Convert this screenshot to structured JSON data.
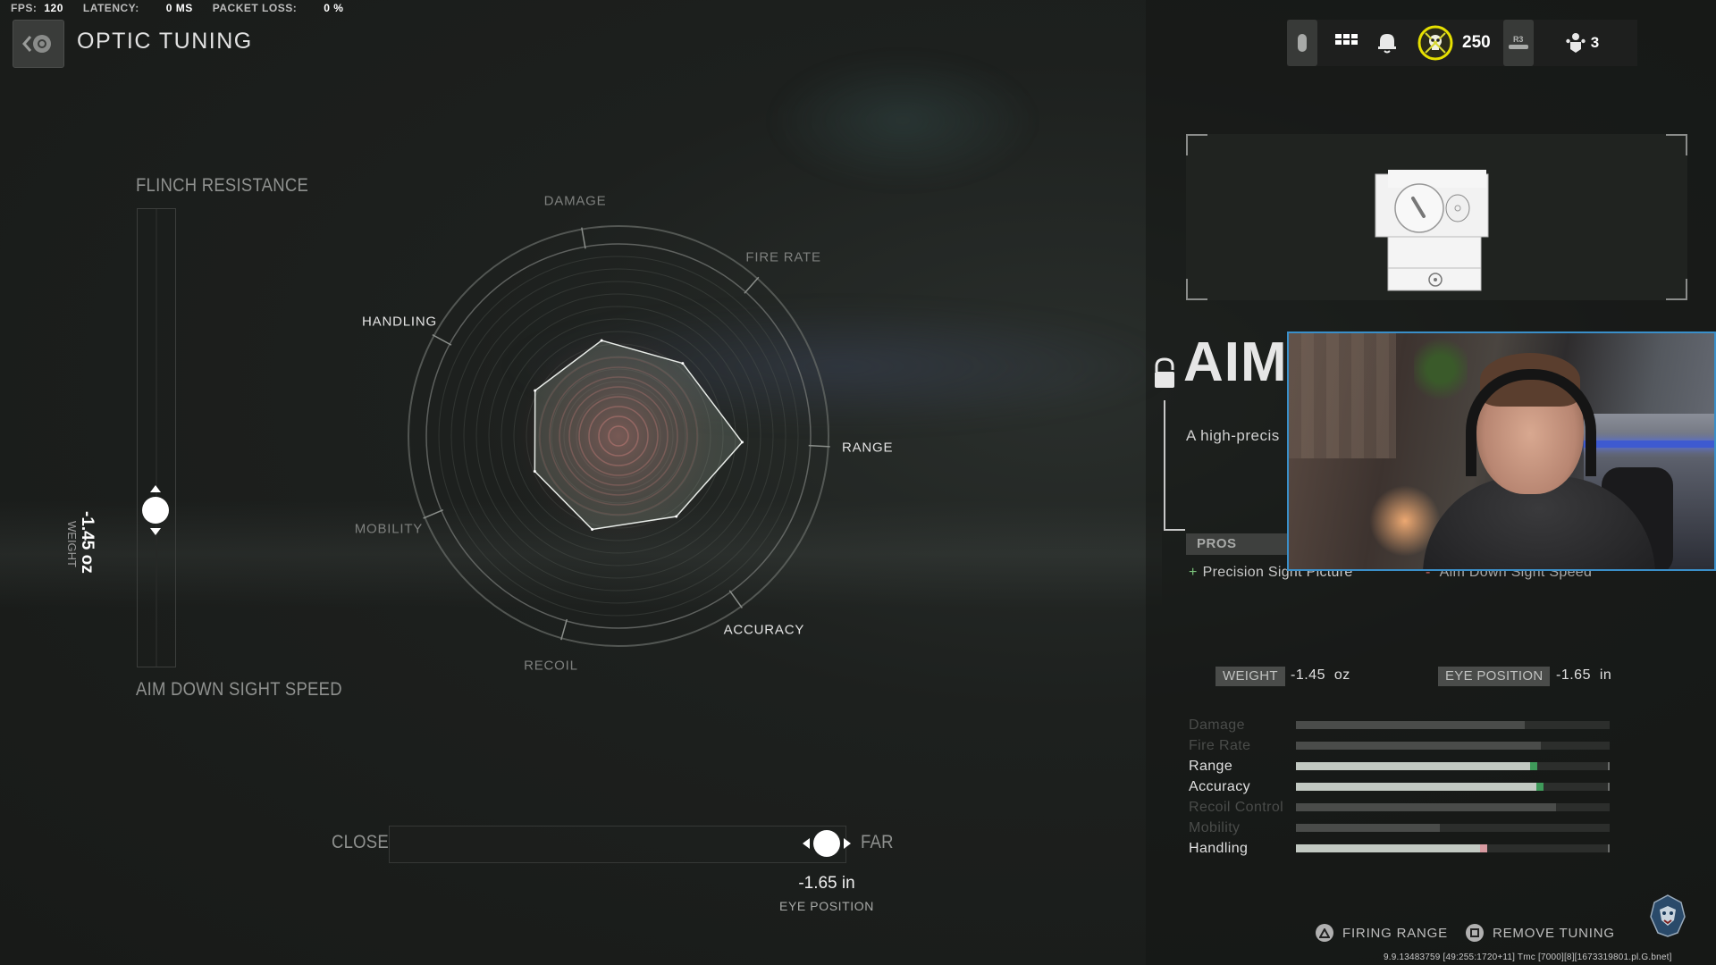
{
  "perf": {
    "fps_label": "FPS:",
    "fps_value": "120",
    "latency_label": "LATENCY:",
    "latency_value": "0 MS",
    "packet_loss_label": "PACKET LOSS:",
    "packet_loss_value": "0 %"
  },
  "header": {
    "back_icon": "back-optic-icon",
    "title": "OPTIC TUNING"
  },
  "topbar": {
    "touchpad_icon": "touchpad-icon",
    "menu_icon": "grid-menu-icon",
    "notifications_icon": "bell-icon",
    "currency_icon": "cod-points-icon",
    "currency_value": "250",
    "r3_label": "R3",
    "squad_icon": "party-icon",
    "squad_count": "3"
  },
  "vertical_tuning": {
    "top_label": "FLINCH RESISTANCE",
    "bottom_label": "AIM DOWN SIGHT SPEED",
    "value": "-1.45 oz",
    "value_name": "WEIGHT",
    "position_from_bottom": 0.34
  },
  "horizontal_tuning": {
    "left_label": "CLOSE",
    "right_label": "FAR",
    "value": "-1.65 in",
    "value_name": "EYE POSITION",
    "position_from_left": 0.96
  },
  "radar": {
    "axes": [
      {
        "label": "DAMAGE",
        "value": 0.47,
        "lit": false
      },
      {
        "label": "FIRE RATE",
        "value": 0.47,
        "lit": false
      },
      {
        "label": "RANGE",
        "value": 0.6,
        "lit": true
      },
      {
        "label": "ACCURACY",
        "value": 0.48,
        "lit": true
      },
      {
        "label": "RECOIL",
        "value": 0.47,
        "lit": false
      },
      {
        "label": "MOBILITY",
        "value": 0.44,
        "lit": false
      },
      {
        "label": "HANDLING",
        "value": 0.46,
        "lit": true
      }
    ]
  },
  "attachment": {
    "name": "AIM",
    "description": "A high-precis",
    "lock_icon": "unlocked-padlock-icon",
    "pros_header": "PROS",
    "pros": [
      "Precision Sight Picture"
    ],
    "cons": [
      "Aim Down Sight Speed"
    ],
    "pro_prefix": "+",
    "con_prefix": "-"
  },
  "tuning_readout": {
    "weight_label": "WEIGHT",
    "weight_value": "-1.45  oz",
    "eye_label": "EYE POSITION",
    "eye_value": "-1.65  in"
  },
  "stats": [
    {
      "name": "Damage",
      "value": 0.73,
      "lit": false,
      "tip": null
    },
    {
      "name": "Fire Rate",
      "value": 0.78,
      "lit": false,
      "tip": null
    },
    {
      "name": "Range",
      "value": 0.77,
      "lit": true,
      "tip": "#3f9a5a"
    },
    {
      "name": "Accuracy",
      "value": 0.79,
      "lit": true,
      "tip": "#3f9a5a"
    },
    {
      "name": "Recoil Control",
      "value": 0.83,
      "lit": false,
      "tip": null
    },
    {
      "name": "Mobility",
      "value": 0.46,
      "lit": false,
      "tip": null
    },
    {
      "name": "Handling",
      "value": 0.61,
      "lit": true,
      "tip": "#d79aa0"
    }
  ],
  "actions": {
    "firing_range_label": "FIRING RANGE",
    "firing_range_icon": "triangle-button-icon",
    "remove_tuning_label": "REMOVE TUNING",
    "remove_tuning_icon": "square-button-icon"
  },
  "build_string": "9.9.13483759 [49:255:1720+11] Tmc [7000][8][1673319801.pl.G.bnet]",
  "colors": {
    "webcam_border": "#3a8fc9",
    "currency_ring": "#e6e000",
    "stat_pos": "#3f9a5a",
    "stat_neg": "#d79aa0"
  }
}
